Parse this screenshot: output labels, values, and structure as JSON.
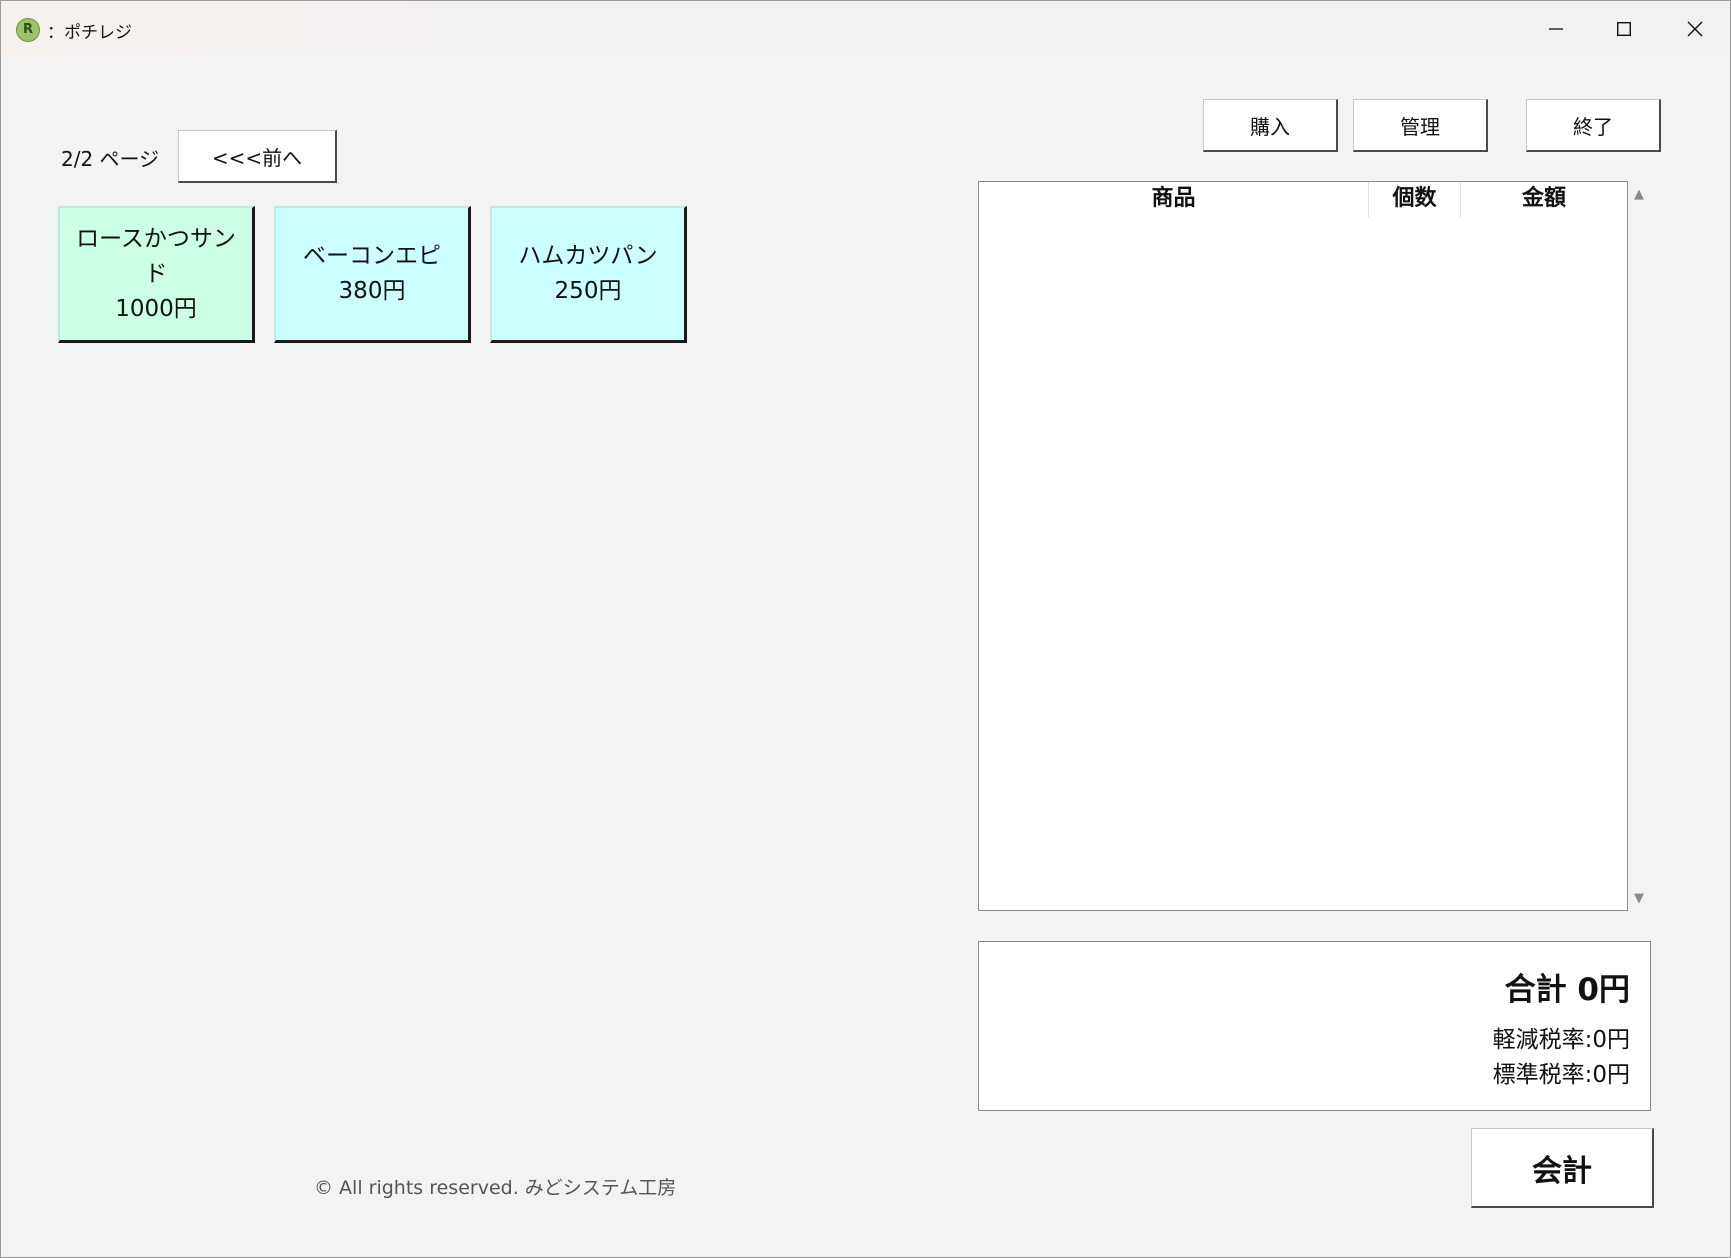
{
  "window": {
    "title": "：ポチレジ",
    "icon_letter": "R",
    "minimize": "minimize-icon",
    "maximize": "maximize-icon",
    "close": "close-icon"
  },
  "paging": {
    "page_label": "2/2 ページ",
    "prev_button": "<<<前へ"
  },
  "toolbar": {
    "purchase": "購入",
    "manage": "管理",
    "exit": "終了"
  },
  "products": [
    {
      "name_line1": "ロースかつサン",
      "name_line2": "ド",
      "price": "1000円",
      "color": "#ccffe5"
    },
    {
      "name_line1": "ベーコンエピ",
      "name_line2": "",
      "price": "380円",
      "color": "#ccffff"
    },
    {
      "name_line1": "ハムカツパン",
      "name_line2": "",
      "price": "250円",
      "color": "#ccffff"
    }
  ],
  "cart": {
    "headers": [
      "商品",
      "個数",
      "金額"
    ],
    "rows": []
  },
  "totals": {
    "total": "合計 0円",
    "reduced_tax": "軽減税率:0円",
    "standard_tax": "標準税率:0円"
  },
  "checkout_button": "会計",
  "footer": {
    "copyright": "© All rights reserved. みどシステム工房"
  }
}
